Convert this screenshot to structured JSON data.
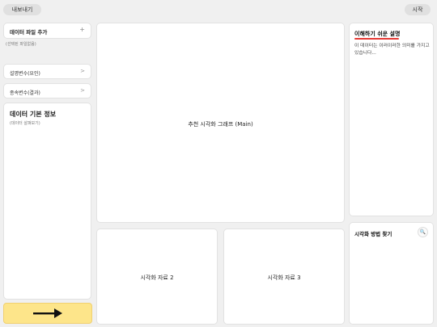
{
  "toolbar": {
    "export_label": "내보내기",
    "start_label": "시작"
  },
  "left": {
    "add_file": {
      "title": "데이터 파일 추가",
      "sub": "(선택된 파일없음)"
    },
    "independent_label": "설명변수(요인)",
    "dependent_label": "종속변수(결과)",
    "data_info": {
      "title": "데이터 기본 정보",
      "sub": "(데이터 살펴보기)"
    }
  },
  "center": {
    "main_chart_label": "추천 시각화 그래프 (Main)",
    "chart2_label": "시각화 자료 2",
    "chart3_label": "시각화 자료 3"
  },
  "right": {
    "explain_title": "이해하기 쉬운 설명",
    "explain_body": "이 데이터는 이러이러한 의미를 가지고 있습니다...",
    "method_title": "시각화 방법 찾기"
  },
  "colors": {
    "accent_underline": "#e53935",
    "next_button": "#fde58a"
  },
  "icons": {
    "plus": "+",
    "chevron": ">",
    "search": "🔍"
  }
}
